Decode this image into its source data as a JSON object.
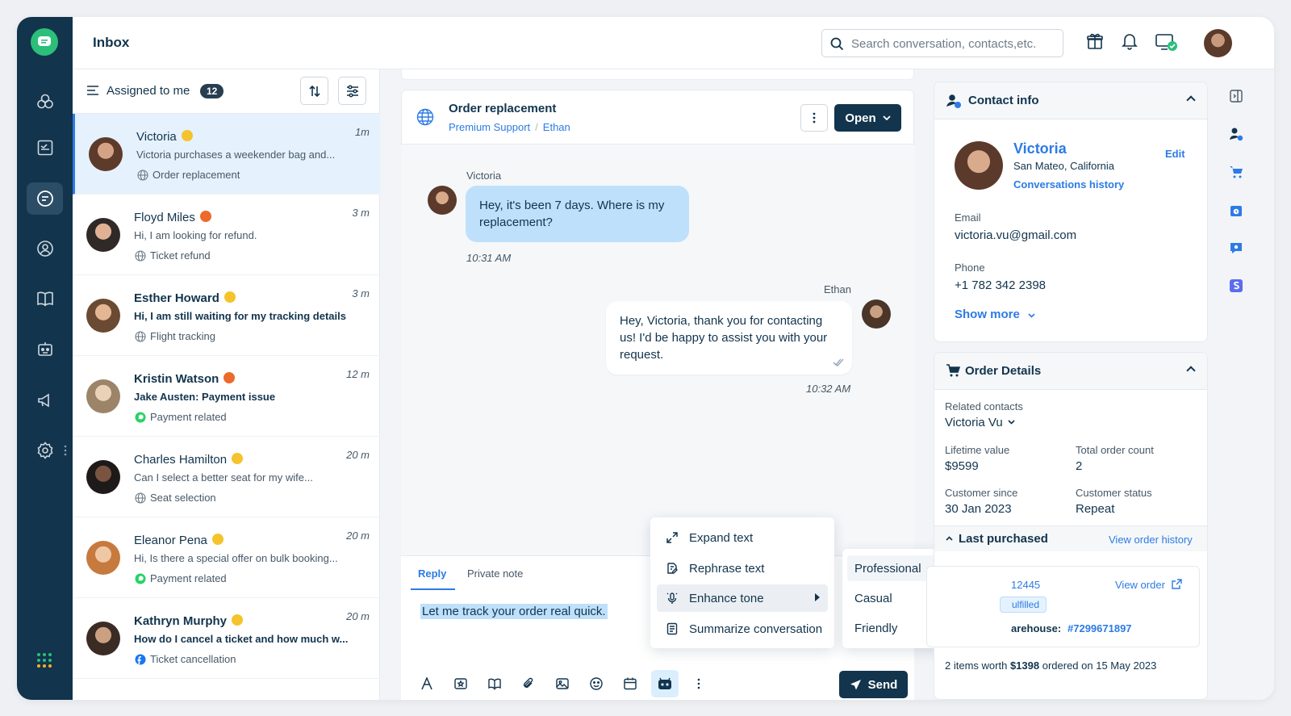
{
  "header": {
    "title": "Inbox",
    "search_placeholder": "Search conversation, contacts,etc."
  },
  "list": {
    "filter_label": "Assigned to me",
    "count": "12",
    "conversations": [
      {
        "name": "Victoria",
        "time": "1m",
        "preview": "Victoria purchases a weekender bag and...",
        "tag": "Order replacement",
        "emoji": "y",
        "bold": false
      },
      {
        "name": "Floyd Miles",
        "time": "3 m",
        "preview": "Hi, I am looking for refund.",
        "tag": "Ticket refund",
        "emoji": "r",
        "bold": false
      },
      {
        "name": "Esther Howard",
        "time": "3 m",
        "preview": "Hi, I am still waiting for my tracking details",
        "tag": "Flight tracking",
        "emoji": "y",
        "bold": true
      },
      {
        "name": "Kristin Watson",
        "time": "12 m",
        "preview": "Jake Austen: Payment issue",
        "tag": "Payment related",
        "emoji": "r",
        "bold": true
      },
      {
        "name": "Charles Hamilton",
        "time": "20 m",
        "preview": "Can I select a better seat for my wife...",
        "tag": "Seat selection",
        "emoji": "y",
        "bold": false
      },
      {
        "name": "Eleanor Pena",
        "time": "20 m",
        "preview": "Hi, Is there a special offer on bulk booking...",
        "tag": "Payment related",
        "emoji": "y",
        "bold": false
      },
      {
        "name": "Kathryn Murphy",
        "time": "20 m",
        "preview": "How do I cancel a ticket and how much w...",
        "tag": "Ticket cancellation",
        "emoji": "y",
        "bold": true
      }
    ]
  },
  "chat": {
    "title": "Order replacement",
    "group": "Premium Support",
    "agent": "Ethan",
    "status": "Open",
    "messages": {
      "in_name": "Victoria",
      "in_text": "Hey, it's been 7 days. Where is my replacement?",
      "in_time": "10:31 AM",
      "out_name": "Ethan",
      "out_text": "Hey, Victoria, thank you for contacting us! I'd be happy to assist you with your request.",
      "out_time": "10:32 AM"
    },
    "reply_tab": "Reply",
    "note_tab": "Private note",
    "draft": "Let me track your order real quick.",
    "send_label": "Send"
  },
  "ai_menu": {
    "items": [
      "Expand text",
      "Rephrase text",
      "Enhance tone",
      "Summarize conversation"
    ],
    "tones": [
      "Professional",
      "Casual",
      "Friendly"
    ]
  },
  "contact": {
    "header": "Contact info",
    "name": "Victoria",
    "location": "San Mateo, California",
    "history_link": "Conversations history",
    "edit": "Edit",
    "email_label": "Email",
    "email": "victoria.vu@gmail.com",
    "phone_label": "Phone",
    "phone": "+1 782 342 2398",
    "show_more": "Show more"
  },
  "order": {
    "header": "Order Details",
    "related_label": "Related contacts",
    "related": "Victoria Vu",
    "ltv_label": "Lifetime value",
    "ltv": "$9599",
    "count_label": "Total order count",
    "count": "2",
    "since_label": "Customer since",
    "since": "30 Jan 2023",
    "status_label": "Customer status",
    "status": "Repeat",
    "last_purchased": "Last purchased",
    "history_link": "View order history",
    "order_no": "12445",
    "view_order": "View order",
    "fulfilled": "ulfilled",
    "warehouse_label": "arehouse:",
    "warehouse": "#7299671897",
    "summary_pre": "2 items worth",
    "summary_amount": "$1398",
    "summary_mid": "ordered on",
    "summary_date": "15 May 2023"
  },
  "colors": {
    "navy": "#12344d",
    "blue": "#2c7be5",
    "green": "#2bbf7a",
    "bubble": "#bfe0fb"
  }
}
